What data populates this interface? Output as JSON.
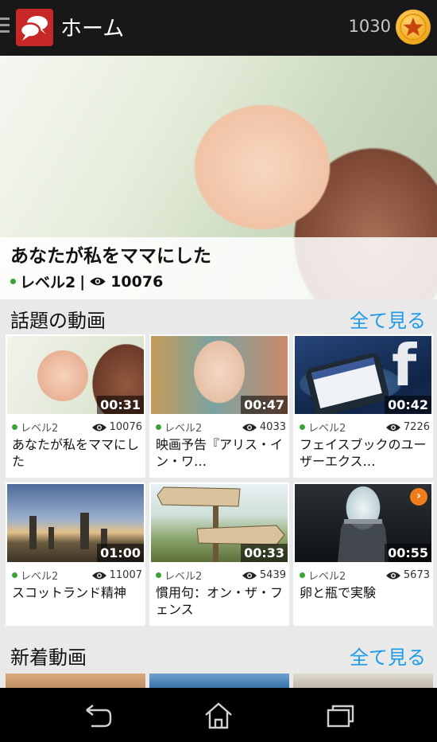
{
  "header": {
    "title": "ホーム",
    "coins": "1030",
    "menu_icon": "hamburger-icon",
    "logo_icon": "chat-bubbles-icon",
    "coin_icon": "star-coin-icon"
  },
  "featured": {
    "title": "あなたが私をママにした",
    "level": "レベル2",
    "separator": "|",
    "views": "10076"
  },
  "trending": {
    "title": "話題の動画",
    "see_all": "全て見る",
    "videos": [
      {
        "duration": "00:31",
        "level": "レベル2",
        "views": "10076",
        "title": "あなたが私をママにした"
      },
      {
        "duration": "00:47",
        "level": "レベル2",
        "views": "4033",
        "title": "映画予告『アリス・イン・ワ…"
      },
      {
        "duration": "00:42",
        "level": "レベル2",
        "views": "7226",
        "title": "フェイスブックのユーザーエクス…"
      },
      {
        "duration": "01:00",
        "level": "レベル2",
        "views": "11007",
        "title": "スコットランド精神"
      },
      {
        "duration": "00:33",
        "level": "レベル2",
        "views": "5439",
        "title": "慣用句：オン・ザ・フェンス"
      },
      {
        "duration": "00:55",
        "level": "レベル2",
        "views": "5673",
        "title": "卵と瓶で実験",
        "badge": "›"
      }
    ]
  },
  "new_videos": {
    "title": "新着動画",
    "see_all": "全て見る"
  },
  "colors": {
    "accent": "#1e9be8",
    "app_bar": "#181818",
    "level_dot": "#3aa336",
    "logo": "#c62828",
    "badge": "#f07d1b"
  },
  "navbar": {
    "back_icon": "back-icon",
    "home_icon": "home-icon",
    "recents_icon": "recents-icon"
  }
}
